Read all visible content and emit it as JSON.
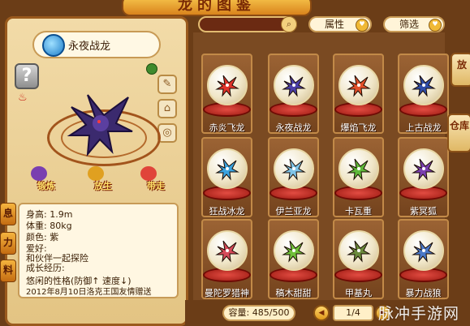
{
  "banner": {
    "title": "龙的图鉴"
  },
  "dragon": {
    "name": "永夜战龙",
    "actions": [
      "锻炼",
      "放生",
      "带走"
    ],
    "info": {
      "height_label": "身高:",
      "height_value": "1.9m",
      "weight_label": "体重:",
      "weight_value": "80kg",
      "color_label": "颜色:",
      "color_value": "紫",
      "hobby_label": "爱好:",
      "hobby_value": "和伙伴一起探险",
      "history_label": "成长经历:",
      "personality": "悠闲的性格(防御↑ 速度↓)",
      "origin": "2012年8月10日洛克王国友情赠送"
    }
  },
  "left_tabs": [
    "息",
    "力",
    "料"
  ],
  "filters": {
    "attribute": "属性",
    "filter": "筛选"
  },
  "grid": [
    {
      "name": "赤炎飞龙",
      "color": "#e0332b"
    },
    {
      "name": "永夜战龙",
      "color": "#4b3fa8"
    },
    {
      "name": "爆焰飞龙",
      "color": "#e2502a"
    },
    {
      "name": "上古战龙",
      "color": "#2f4da8"
    },
    {
      "name": "狂战冰龙",
      "color": "#3aa3e0"
    },
    {
      "name": "伊兰亚龙",
      "color": "#7fc4e8"
    },
    {
      "name": "卡瓦重",
      "color": "#5fb83a"
    },
    {
      "name": "紫冥狐",
      "color": "#7a3fb0"
    },
    {
      "name": "曼陀罗猎神",
      "color": "#d64a5a"
    },
    {
      "name": "稿木甜甜",
      "color": "#6fbf3a"
    },
    {
      "name": "甲基丸",
      "color": "#6a8a3c"
    },
    {
      "name": "暴力战狼",
      "color": "#4a78c8"
    }
  ],
  "right_tabs": [
    "放",
    "仓库"
  ],
  "footer": {
    "capacity": "容量: 485/500",
    "page": "1/4"
  },
  "watermark": "脉冲手游网"
}
